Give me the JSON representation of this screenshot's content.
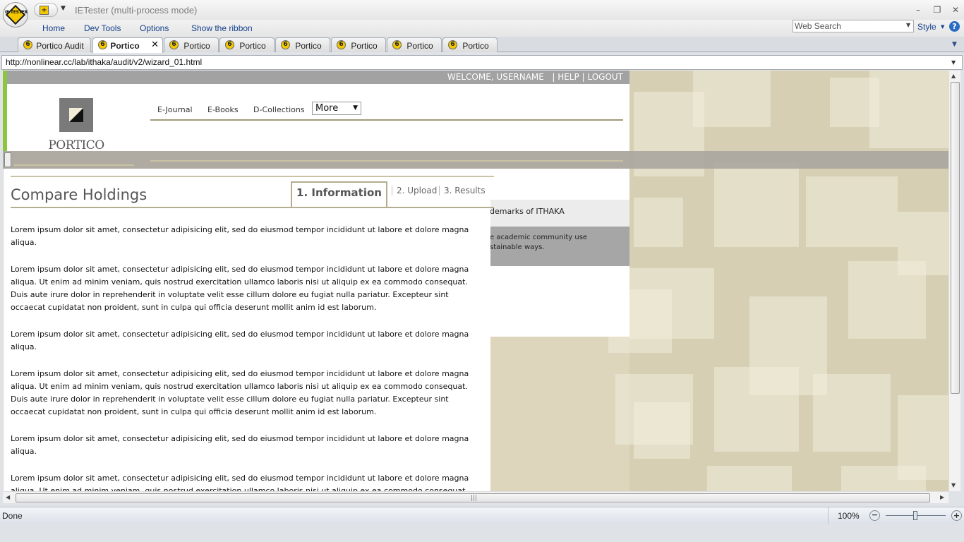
{
  "window": {
    "title": "IETester (multi-process mode)",
    "logo_text": "IE TESTER",
    "qat_icon": "+",
    "minimize": "–",
    "restore": "❐",
    "close": "✕"
  },
  "ribbon": {
    "tabs": [
      "Home",
      "Dev Tools",
      "Options",
      "Show the ribbon"
    ],
    "search_value": "Web Search",
    "style_label": "Style",
    "help_glyph": "?"
  },
  "tabs": [
    {
      "label": "Portico Audit",
      "active": false
    },
    {
      "label": "Portico",
      "active": true
    },
    {
      "label": "Portico",
      "active": false
    },
    {
      "label": "Portico",
      "active": false
    },
    {
      "label": "Portico",
      "active": false
    },
    {
      "label": "Portico",
      "active": false
    },
    {
      "label": "Portico",
      "active": false
    },
    {
      "label": "Portico",
      "active": false
    }
  ],
  "tab_icon_glyph": "6",
  "tab_close_glyph": "✕",
  "address": {
    "url": "http://nonlinear.cc/lab/ithaka/audit/v2/wizard_01.html"
  },
  "site": {
    "topbar": {
      "welcome": "WELCOME, USERNAME",
      "help": "HELP",
      "logout": "LOGOUT",
      "separator": "|"
    },
    "logo_text": "PORTICO",
    "nav": [
      "E-Journal",
      "E-Books",
      "D-Collections"
    ],
    "more_select": {
      "value": "More"
    },
    "side_panel": {
      "line1": "demarks of ITHAKA",
      "line2a": "e academic community use",
      "line2b": "stainable ways."
    },
    "page_title": "Compare Holdings",
    "steps": [
      "1. Information",
      "2. Upload",
      "3. Results"
    ],
    "paragraphs": [
      "Lorem ipsum dolor sit amet, consectetur adipisicing elit, sed do eiusmod tempor incididunt ut labore et dolore magna aliqua.",
      "Lorem ipsum dolor sit amet, consectetur adipisicing elit, sed do eiusmod tempor incididunt ut labore et dolore magna aliqua. Ut enim ad minim veniam, quis nostrud exercitation ullamco laboris nisi ut aliquip ex ea commodo consequat. Duis aute irure dolor in reprehenderit in voluptate velit esse cillum dolore eu fugiat nulla pariatur. Excepteur sint occaecat cupidatat non proident, sunt in culpa qui officia deserunt mollit anim id est laborum.",
      "Lorem ipsum dolor sit amet, consectetur adipisicing elit, sed do eiusmod tempor incididunt ut labore et dolore magna aliqua.",
      "Lorem ipsum dolor sit amet, consectetur adipisicing elit, sed do eiusmod tempor incididunt ut labore et dolore magna aliqua. Ut enim ad minim veniam, quis nostrud exercitation ullamco laboris nisi ut aliquip ex ea commodo consequat. Duis aute irure dolor in reprehenderit in voluptate velit esse cillum dolore eu fugiat nulla pariatur. Excepteur sint occaecat cupidatat non proident, sunt in culpa qui officia deserunt mollit anim id est laborum.",
      "Lorem ipsum dolor sit amet, consectetur adipisicing elit, sed do eiusmod tempor incididunt ut labore et dolore magna aliqua.",
      "Lorem ipsum dolor sit amet, consectetur adipisicing elit, sed do eiusmod tempor incididunt ut labore et dolore magna aliqua. Ut enim ad minim veniam, quis nostrud exercitation ullamco laboris nisi ut aliquip ex ea commodo consequat."
    ]
  },
  "statusbar": {
    "status": "Done",
    "zoom": "100%"
  },
  "colors": {
    "accent_green": "#8cc63f",
    "brand_gray": "#a2a2a2",
    "ribbon_text": "#15428b",
    "underline_khaki": "#b4ad8f"
  }
}
